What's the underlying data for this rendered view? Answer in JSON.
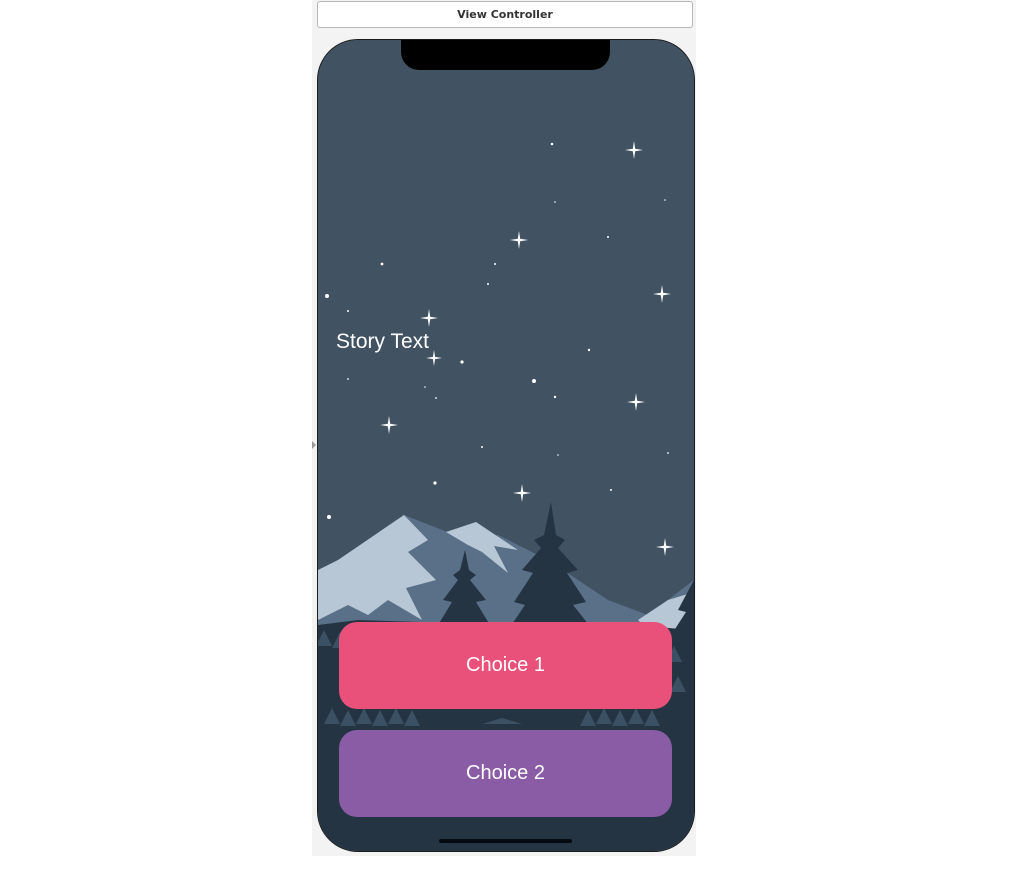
{
  "header": {
    "title": "View Controller"
  },
  "story": {
    "text": "Story Text"
  },
  "choices": [
    {
      "label": "Choice 1",
      "color": "#E9517A"
    },
    {
      "label": "Choice 2",
      "color": "#8A5CA6"
    }
  ],
  "scene": {
    "sky_color": "#415263",
    "mountain_light_color": "#B7C7D6",
    "mountain_mid_color": "#5A6F88",
    "tree_color": "#253443"
  }
}
